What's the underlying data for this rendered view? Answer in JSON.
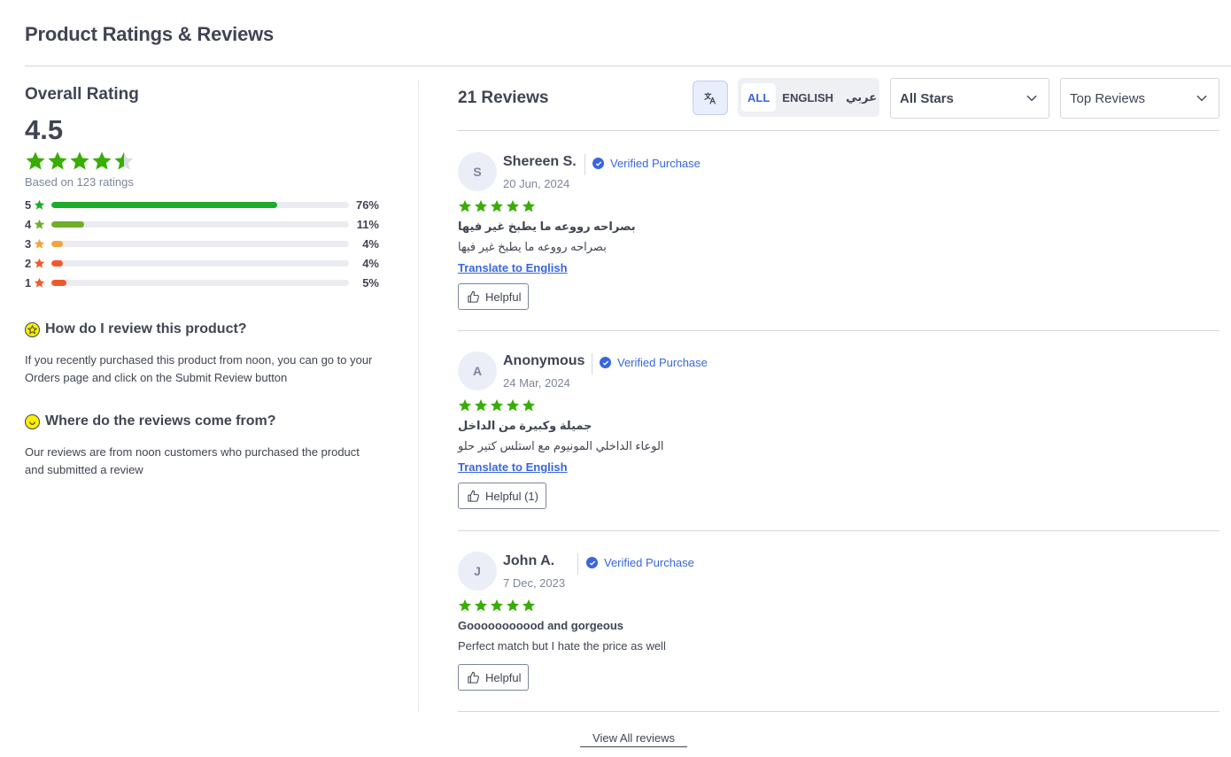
{
  "page": {
    "title": "Product Ratings & Reviews"
  },
  "overall": {
    "heading": "Overall Rating",
    "score": "4.5",
    "stars_value": 4.5,
    "based_on": "Based on 123 ratings",
    "distribution": [
      {
        "stars": "5",
        "pct_label": "76%",
        "pct": 76,
        "color": "#1dac2a"
      },
      {
        "stars": "4",
        "pct_label": "11%",
        "pct": 11,
        "color": "#6fad2a"
      },
      {
        "stars": "3",
        "pct_label": "4%",
        "pct": 4,
        "color": "#f3a43b"
      },
      {
        "stars": "2",
        "pct_label": "4%",
        "pct": 4,
        "color": "#f05a2b"
      },
      {
        "stars": "1",
        "pct_label": "5%",
        "pct": 5,
        "color": "#f05a2b"
      }
    ]
  },
  "faq": [
    {
      "icon": "star-face-icon",
      "question": "How do I review this product?",
      "answer": "If you recently purchased this product from noon, you can go to your Orders page and click on the Submit Review button"
    },
    {
      "icon": "smiley-icon",
      "question": "Where do the reviews come from?",
      "answer": "Our reviews are from noon customers who purchased the product and submitted a review"
    }
  ],
  "reviews_header": {
    "count_label": "21 Reviews",
    "languages": [
      "ALL",
      "ENGLISH",
      "عربي"
    ],
    "active_language": "ALL",
    "stars_filter": "All Stars",
    "sort": "Top Reviews"
  },
  "reviews": [
    {
      "initial": "S",
      "author": "Shereen S.",
      "verified": "Verified Purchase",
      "date": "20 Jun, 2024",
      "stars": 5,
      "title": "بصراحه رووعه ما يطبخ غير فيها",
      "body": "بصراحه رووعه ما يطبخ غير فيها",
      "translate": "Translate to English",
      "helpful": "Helpful"
    },
    {
      "initial": "A",
      "author": "Anonymous",
      "verified": "Verified Purchase",
      "date": "24 Mar, 2024",
      "stars": 5,
      "title": "جميلة وكبيرة من الداخل",
      "body": "الوعاء الداخلي المونيوم مع استلس كتير حلو",
      "translate": "Translate to English",
      "helpful": "Helpful (1)"
    },
    {
      "initial": "J",
      "author": "John A.",
      "verified": "Verified Purchase",
      "date": "7 Dec, 2023",
      "stars": 5,
      "title": "Gooooooooood and gorgeous",
      "body": "Perfect match but I hate the price as well",
      "translate": "",
      "helpful": "Helpful"
    }
  ],
  "footer": {
    "view_all": "View All reviews"
  },
  "colors": {
    "accent": "#3866df",
    "star_green": "#38ae04",
    "text": "#404553"
  }
}
